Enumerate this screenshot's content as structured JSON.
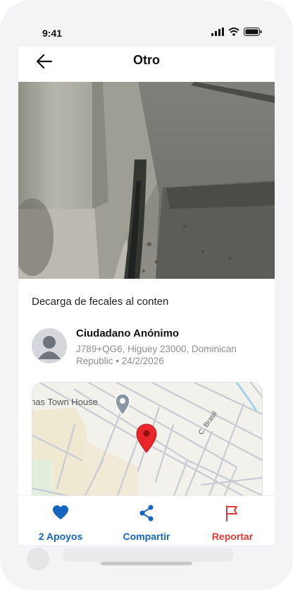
{
  "status_bar": {
    "time": "9:41"
  },
  "header": {
    "title": "Otro"
  },
  "report": {
    "description": "Decarga de fecales al conten",
    "author_name": "Ciudadano Anónimo",
    "location_date": "J789+QG6, Higuey 23000, Dominican Republic • 24/2/2026"
  },
  "map": {
    "poi_label": "nas Town House",
    "street_label": "C. Brasil"
  },
  "actions": {
    "support_label": "2 Apoyos",
    "share_label": "Compartir",
    "report_label": "Reportar"
  },
  "colors": {
    "primary": "#1565c0",
    "danger": "#e53935",
    "pin": "#e8262b"
  }
}
